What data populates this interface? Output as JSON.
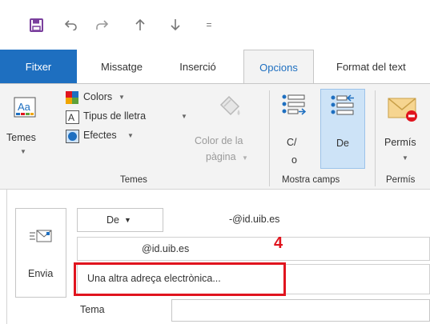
{
  "quick_access": {
    "icons": [
      "save-icon",
      "undo-icon",
      "redo-icon",
      "up-arrow-icon",
      "down-arrow-icon",
      "customize-icon"
    ],
    "customize_glyph": "="
  },
  "tabs": [
    {
      "label": "Fitxer"
    },
    {
      "label": "Missatge"
    },
    {
      "label": "Inserció"
    },
    {
      "label": "Opcions"
    },
    {
      "label": "Format del text"
    }
  ],
  "ribbon": {
    "temes_group": {
      "themes_label": "Temes",
      "colors_label": "Colors",
      "fonts_label": "Tipus de lletra",
      "effects_label": "Efectes",
      "page_color_label_1": "Color de la",
      "page_color_label_2": "pàgina",
      "group_label": "Temes"
    },
    "show_fields_group": {
      "cc_label_1": "C/",
      "cc_label_2": "o",
      "from_label": "De",
      "group_label": "Mostra camps"
    },
    "permission_group": {
      "permission_label": "Permís",
      "group_label": "Permís"
    }
  },
  "compose": {
    "send_label": "Envia",
    "from_button_label": "De",
    "from_address": "-@id.uib.es",
    "dropdown_address": "@id.uib.es",
    "other_address_option": "Una altra adreça electrònica...",
    "subject_label": "Tema",
    "annotation_number": "4"
  },
  "colors": {
    "file_tab": "#1e6fc0",
    "active_tab_text": "#1e6fc0",
    "highlight": "#e0141e",
    "annotation": "#e0141e",
    "save_icon": "#7a3f9d"
  }
}
